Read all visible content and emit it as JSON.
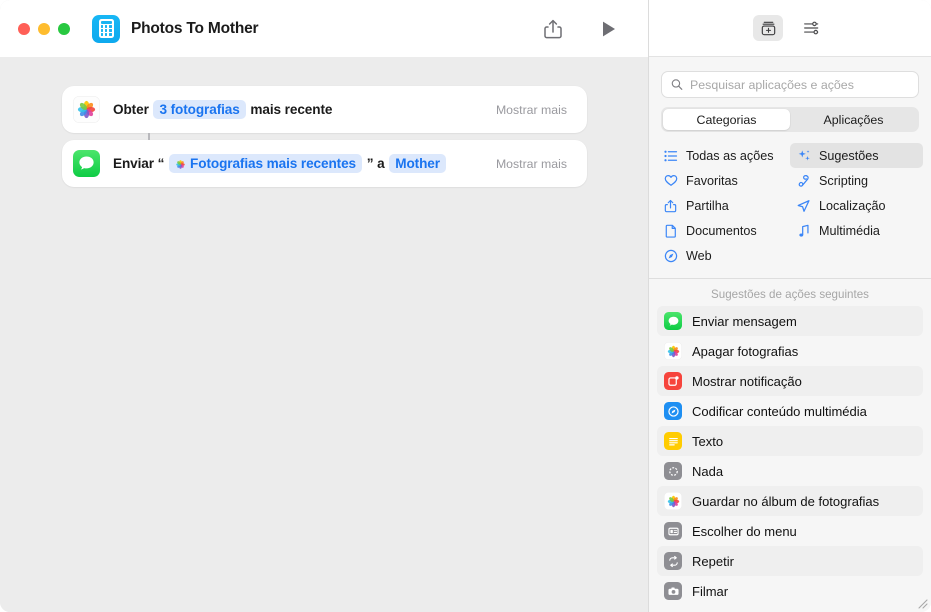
{
  "window": {
    "traffic_lights": [
      "close",
      "minimize",
      "zoom"
    ],
    "doc_title": "Photos To Mother",
    "app_icon": "shortcuts-calculator-icon",
    "share_button": "share-icon",
    "run_button": "play-icon"
  },
  "workflow": {
    "actions": [
      {
        "app_icon": "photos-app-icon",
        "prefix": "Obter",
        "token1": "3 fotografias",
        "suffix": "mais recente",
        "show_more": "Mostrar mais"
      },
      {
        "app_icon": "messages-app-icon",
        "prefix": "Enviar “",
        "token1": "Fotografias mais recentes",
        "middle": "” a",
        "token2": "Mother",
        "show_more": "Mostrar mais"
      }
    ]
  },
  "library": {
    "header_buttons": [
      {
        "name": "action-library-icon",
        "active": true
      },
      {
        "name": "shortcut-details-sliders-icon",
        "active": false
      }
    ],
    "search": {
      "placeholder": "Pesquisar aplicações e ações",
      "value": "",
      "icon": "search-icon"
    },
    "segments": [
      {
        "label": "Categorias",
        "active": true
      },
      {
        "label": "Aplicações",
        "active": false
      }
    ],
    "categories": [
      {
        "label": "Todas as ações",
        "icon": "list-bullet-icon",
        "selected": false
      },
      {
        "label": "Sugestões",
        "icon": "sparkles-icon",
        "selected": true
      },
      {
        "label": "Favoritas",
        "icon": "heart-icon",
        "selected": false
      },
      {
        "label": "Scripting",
        "icon": "scripting-ribbon-icon",
        "selected": false
      },
      {
        "label": "Partilha",
        "icon": "share-icon",
        "selected": false
      },
      {
        "label": "Localização",
        "icon": "location-arrow-icon",
        "selected": false
      },
      {
        "label": "Documentos",
        "icon": "document-icon",
        "selected": false
      },
      {
        "label": "Multimédia",
        "icon": "music-note-icon",
        "selected": false
      },
      {
        "label": "Web",
        "icon": "safari-compass-icon",
        "selected": false
      }
    ],
    "suggestions_header": "Sugestões de ações seguintes",
    "suggestions": [
      {
        "label": "Enviar mensagem",
        "icon": "messages-app-icon",
        "color": "#32D04F"
      },
      {
        "label": "Apagar fotografias",
        "icon": "photos-app-icon",
        "color": "#FFFFFF"
      },
      {
        "label": "Mostrar notificação",
        "icon": "notification-icon",
        "color": "#F6443C"
      },
      {
        "label": "Codificar conteúdo multimédia",
        "icon": "media-encode-icon",
        "color": "#1E8FF2"
      },
      {
        "label": "Texto",
        "icon": "text-icon",
        "color": "#FFCC00"
      },
      {
        "label": "Nada",
        "icon": "nothing-circle-icon",
        "color": "#8E8E93"
      },
      {
        "label": "Guardar no álbum de fotografias",
        "icon": "photos-app-icon",
        "color": "#FFFFFF"
      },
      {
        "label": "Escolher do menu",
        "icon": "menu-choose-icon",
        "color": "#8E8E93"
      },
      {
        "label": "Repetir",
        "icon": "repeat-icon",
        "color": "#8E8E93"
      },
      {
        "label": "Filmar",
        "icon": "camera-icon",
        "color": "#8E8E93"
      }
    ]
  },
  "colors": {
    "canvas": "#ECECEC",
    "card": "#FFFFFF",
    "token_bg": "#DCE8FC",
    "token_text": "#1A74F0",
    "accent_blue": "#3B86F7",
    "sidebar": "#F6F6F6"
  }
}
